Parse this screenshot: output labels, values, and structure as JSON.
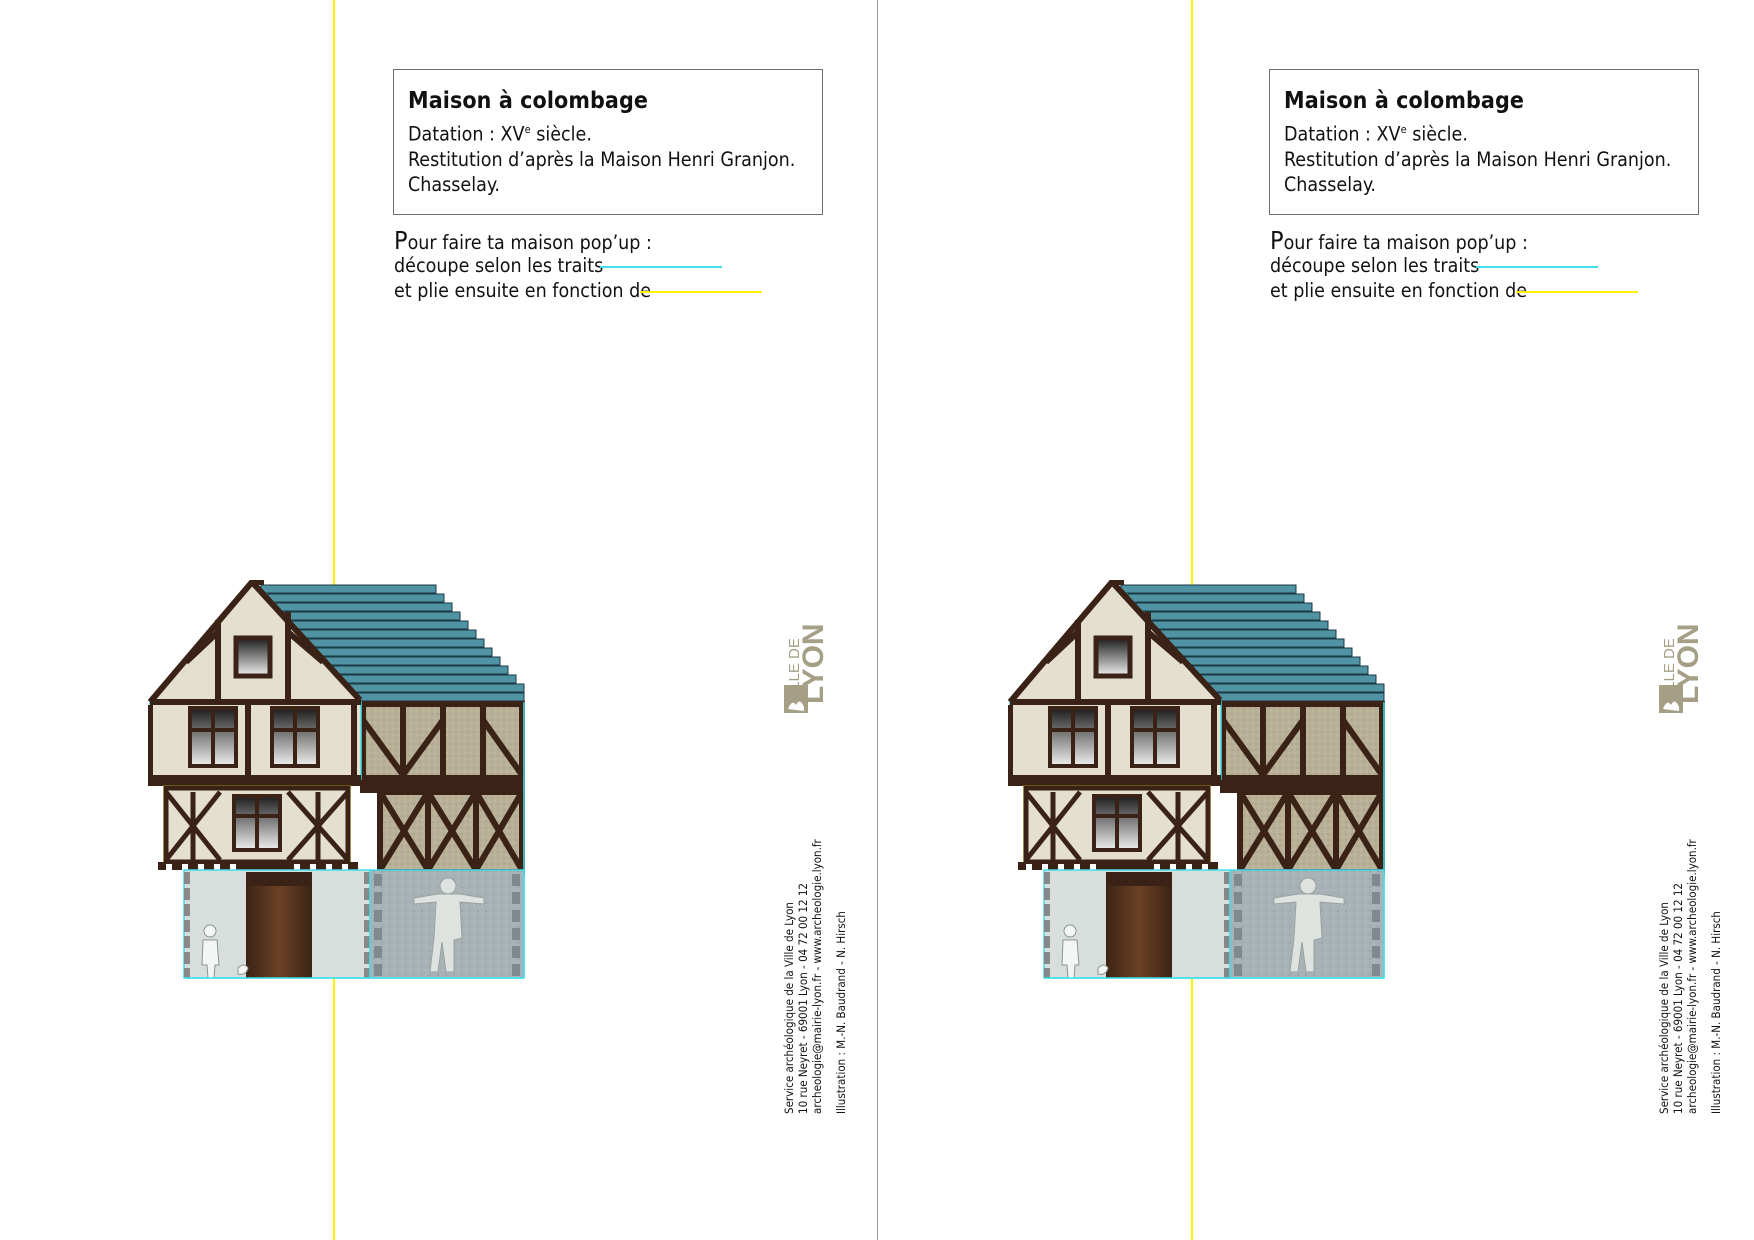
{
  "pages": [
    {
      "info": {
        "title": "Maison à colombage",
        "datation_prefix": "Datation : XV",
        "datation_sup": "e",
        "datation_suffix": " siècle.",
        "restitution": "Restitution d’après la Maison Henri Granjon.",
        "place": "Chasselay."
      },
      "instructions": {
        "line1_initial": "P",
        "line1_rest": "our faire ta maison pop’up :",
        "line2": "découpe selon les traits",
        "line3": "et plie ensuite en fonction de"
      },
      "credits": {
        "line1": "Service archéologique de la Ville de Lyon",
        "line2": "10 rue Neyret - 69001 Lyon - 04 72 00 12 12",
        "line3": "archeologie@mairie-lyon.fr - www.archeologie.lyon.fr",
        "line4": "Illustration : M.-N. Baudrand - N. Hirsch"
      },
      "logo": {
        "top": "VILLE DE",
        "bottom": "LYON"
      }
    },
    {
      "info": {
        "title": "Maison à colombage",
        "datation_prefix": "Datation : XV",
        "datation_sup": "e",
        "datation_suffix": " siècle.",
        "restitution": "Restitution d’après la Maison Henri Granjon.",
        "place": "Chasselay."
      },
      "instructions": {
        "line1_initial": "P",
        "line1_rest": "our faire ta maison pop’up :",
        "line2": "découpe selon les traits",
        "line3": "et plie ensuite en fonction de"
      },
      "credits": {
        "line1": "Service archéologique de la Ville de Lyon",
        "line2": "10 rue Neyret - 69001 Lyon - 04 72 00 12 12",
        "line3": "archeologie@mairie-lyon.fr - www.archeologie.lyon.fr",
        "line4": "Illustration : M.-N. Baudrand - N. Hirsch"
      },
      "logo": {
        "top": "VILLE DE",
        "bottom": "LYON"
      }
    }
  ],
  "colors": {
    "cut_line": "#3fe0ec",
    "fold_line": "#fff100",
    "timber": "#3a2216",
    "roof": "#4f93a5",
    "logo": "#a59f86"
  },
  "icons": [
    "lyon-lion-logo-icon",
    "house-illustration",
    "person-silhouette-icon",
    "hen-icon"
  ]
}
